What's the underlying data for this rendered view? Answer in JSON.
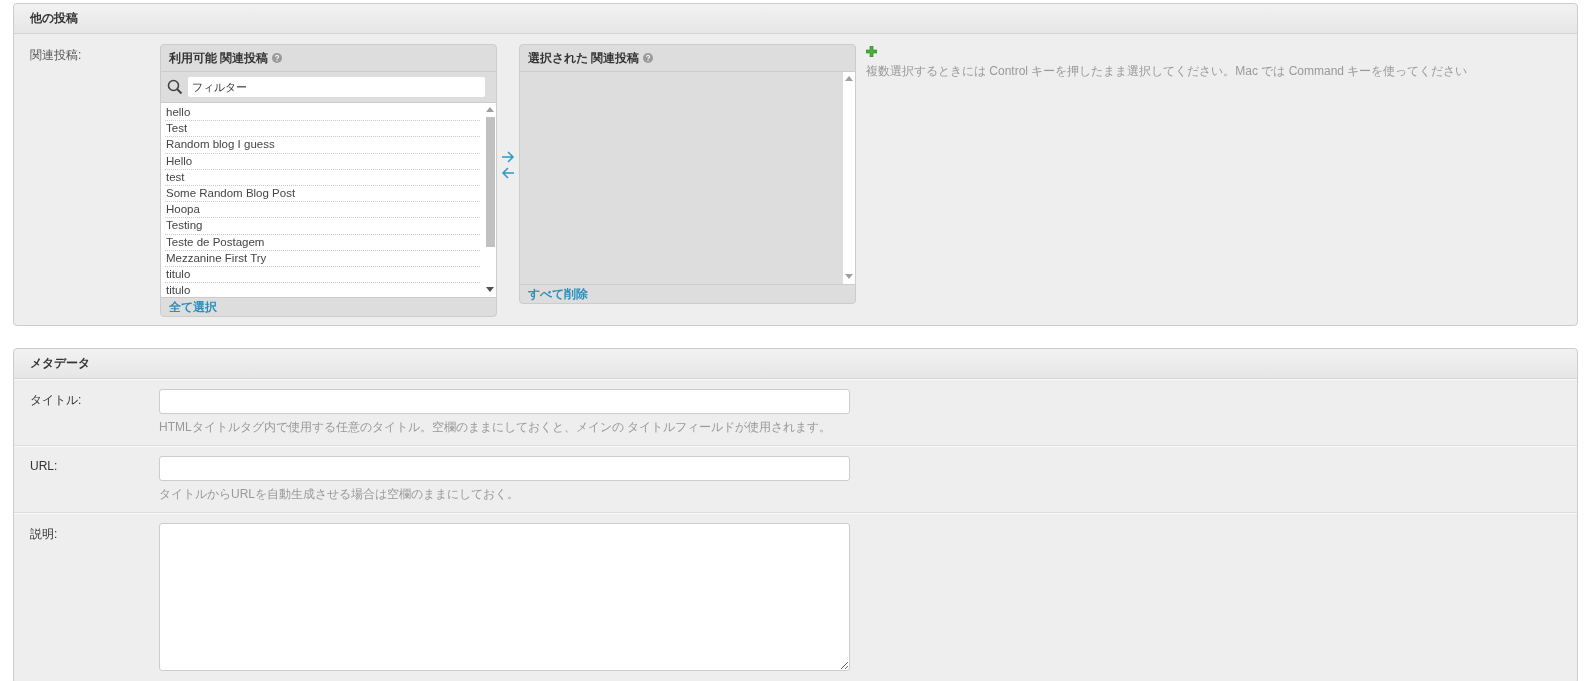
{
  "related_section": {
    "title": "他の投稿",
    "label": "関連投稿:",
    "available": {
      "title": "利用可能 関連投稿",
      "filter": {
        "placeholder": "フィルター"
      },
      "items": [
        "hello",
        "Test",
        "Random blog I guess",
        "Hello",
        "test",
        "Some Random Blog Post",
        "Hoopa",
        "Testing",
        "Teste de Postagem",
        "Mezzanine First Try",
        "titulo",
        "titulo"
      ],
      "action": "全て選択"
    },
    "selected": {
      "title": "選択された 関連投稿",
      "action": "すべて削除"
    },
    "help": "複数選択するときには Control キーを押したまま選択してください。Mac では Command キーを使ってください"
  },
  "metadata_section": {
    "title": "メタデータ",
    "fields": [
      {
        "kind": "input",
        "label": "タイトル:",
        "help": "HTMLタイトルタグ内で使用する任意のタイトル。空欄のままにしておくと、メインの タイトルフィールドが使用されます。"
      },
      {
        "kind": "input",
        "label": "URL:",
        "help": "タイトルからURLを自動生成させる場合は空欄のままにしておく。"
      },
      {
        "kind": "textarea",
        "label": "説明:"
      }
    ]
  }
}
